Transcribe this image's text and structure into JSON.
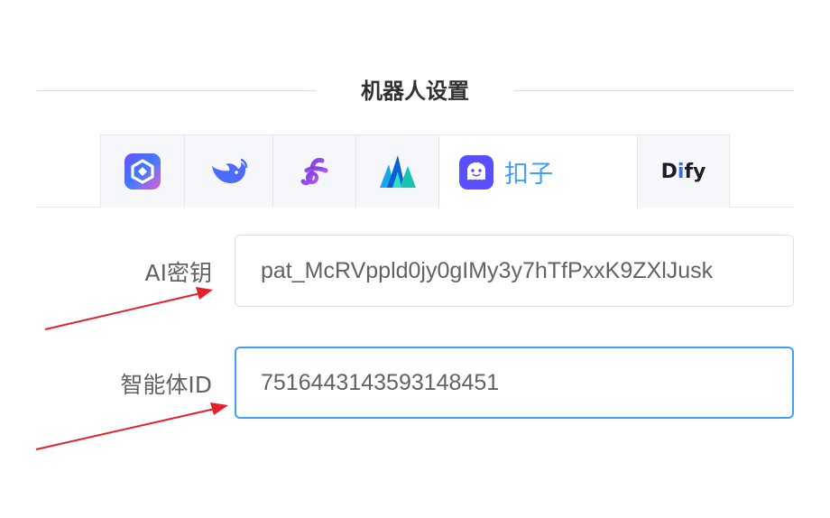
{
  "section": {
    "title": "机器人设置"
  },
  "tabs": [
    {
      "icon": "tongyi-icon",
      "label": ""
    },
    {
      "icon": "deepseek-icon",
      "label": ""
    },
    {
      "icon": "f-logo-icon",
      "label": ""
    },
    {
      "icon": "mountain-icon",
      "label": ""
    },
    {
      "icon": "coze-icon",
      "label": "扣子",
      "active": true
    },
    {
      "icon": "dify-logo",
      "label": "Dify"
    }
  ],
  "form": {
    "api_key": {
      "label": "AI密钥",
      "value": "pat_McRVppld0jy0gIMy3y7hTfPxxK9ZXlJusk"
    },
    "agent_id": {
      "label": "智能体ID",
      "value": "7516443143593148451"
    }
  },
  "colors": {
    "accent": "#409eff",
    "arrow": "#e5202a",
    "border": "#dcdfe6"
  }
}
